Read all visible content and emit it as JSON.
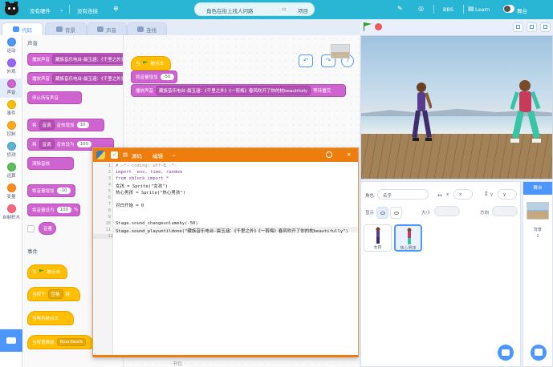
{
  "menubar": {
    "file_menu": "没有硬件",
    "connect_menu": "没有连接",
    "project_title": "角色在街上找人问路",
    "project_menu": "项目",
    "bbs": "BBS",
    "learn": "Learn",
    "mode_toggle": "舞台"
  },
  "tabs": {
    "code": "代码",
    "costumes": "背景",
    "sounds": "声音",
    "connect": "连线"
  },
  "categories": [
    {
      "label": "运动",
      "color": "#4c97ff"
    },
    {
      "label": "外观",
      "color": "#9966ff"
    },
    {
      "label": "声音",
      "color": "#cf63cf"
    },
    {
      "label": "事件",
      "color": "#ffbf00"
    },
    {
      "label": "控制",
      "color": "#ffab19"
    },
    {
      "label": "侦测",
      "color": "#5cb1d6"
    },
    {
      "label": "运算",
      "color": "#59c059"
    },
    {
      "label": "变量",
      "color": "#ff8c1a"
    },
    {
      "label": "自制积木",
      "color": "#ff6680"
    }
  ],
  "palette": {
    "sound_header": "声音",
    "events_header": "事件",
    "play_until_done": "播放声音",
    "sound_name": "藏族音乐电台-晨玉涵：《千里之外》",
    "start_sound": "播放声音",
    "stop_all": "停止所有声音",
    "effect_prefix": "将",
    "pitch": "音调",
    "change_effect": "音效增加",
    "change_val": "10",
    "set_effect": "音效设为",
    "set_val": "100",
    "clear_effects": "清除音效",
    "change_volume": "将音量增加",
    "change_volume_val": "-10",
    "set_volume": "将音量设为",
    "set_volume_val": "100",
    "volume_pct": "%",
    "volume_reporter": "音量",
    "when_flag": "当",
    "when_flag_suffix": "被点击",
    "when_key": "当按下",
    "key": "空格",
    "key_suffix": "键",
    "when_sprite_clicked": "当角色被点击",
    "when_backdrop": "当背景换成",
    "backdrop_name": "Boardwalk"
  },
  "script": {
    "hat_prefix": "当",
    "hat_suffix": "被点击",
    "volume_block": "将音量增加",
    "volume_value": "-50",
    "play_block": "播放声音",
    "play_sound": "藏族音乐电台-晨玉涵：《千里之外》《一剪梅》春风吹开了你的枕beautifully",
    "play_suffix": "等待播完"
  },
  "codewin": {
    "title": "源码",
    "edit": "编辑",
    "line_numbers": [
      "1",
      "2",
      "3",
      "4",
      "5",
      "6",
      "7",
      "8",
      "9",
      "10",
      "11",
      "12"
    ],
    "lines": [
      "# -*- coding: utf-8 -*-",
      "import _env, time, random",
      "from xblock import *",
      "女孩 = Sprite(\"女孩\")",
      "热心男孩 = Sprite(\"热心男孩\")",
      "",
      "对白开始 = 0",
      "",
      "",
      "Stage.sound_changevolumeby(-50)",
      "Stage.sound_playuntildone(\"藏族音乐电台-晨玉涵：《千里之外》《一剪梅》春风吹开了你的枕beautifully\")",
      ""
    ],
    "footer": "书包"
  },
  "sprite_info": {
    "sprite_label": "角色",
    "sprite_name": "名字",
    "x_label": "x",
    "x_value": "x",
    "y_label": "y",
    "y_value": "y",
    "show_label": "显示",
    "size_label": "大小",
    "direction_label": "方向"
  },
  "sprites": [
    {
      "name": "女孩"
    },
    {
      "name": "热心男孩"
    }
  ],
  "stage_selector": {
    "header": "舞台",
    "label": "背景",
    "count": "1"
  }
}
